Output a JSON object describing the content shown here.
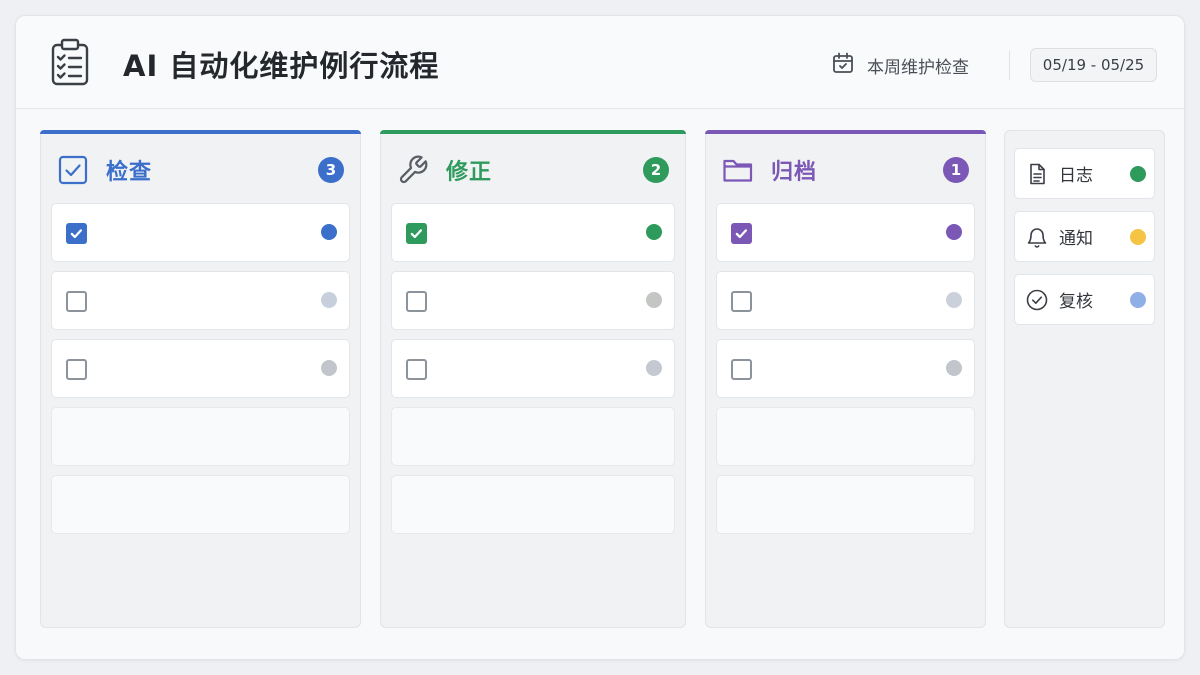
{
  "header": {
    "title": "AI 自动化维护例行流程",
    "week_label": "本周维护检查",
    "date_range": "05/19 - 05/25",
    "icons": {
      "app": "clipboard-checklist-icon",
      "week": "calendar-check-icon"
    }
  },
  "columns": [
    {
      "title": "检查",
      "count": "3",
      "color": "#3b6fc9",
      "icon": "checkbox-icon",
      "tasks": [
        {
          "checked": true,
          "dot": "#3b6fc9"
        },
        {
          "checked": false,
          "dot": "#c7cfdc"
        },
        {
          "checked": false,
          "dot": "#c2c6cc"
        }
      ],
      "empty_slots": 2
    },
    {
      "title": "修正",
      "count": "2",
      "color": "#2e9a5c",
      "icon": "wrench-icon",
      "tasks": [
        {
          "checked": true,
          "dot": "#2e9a5c"
        },
        {
          "checked": false,
          "dot": "#c4c6c4"
        },
        {
          "checked": false,
          "dot": "#c4c9d1"
        }
      ],
      "empty_slots": 2
    },
    {
      "title": "归档",
      "count": "1",
      "color": "#7b57b6",
      "icon": "folder-icon",
      "tasks": [
        {
          "checked": true,
          "dot": "#7b57b6"
        },
        {
          "checked": false,
          "dot": "#cbd1da"
        },
        {
          "checked": false,
          "dot": "#c2c5ca"
        }
      ],
      "empty_slots": 2
    }
  ],
  "sidebar": {
    "items": [
      {
        "label": "日志",
        "icon": "document-icon",
        "dot": "#2e9a5c"
      },
      {
        "label": "通知",
        "icon": "bell-icon",
        "dot": "#f6c445"
      },
      {
        "label": "复核",
        "icon": "check-circle-icon",
        "dot": "#8fb0e6"
      }
    ]
  }
}
